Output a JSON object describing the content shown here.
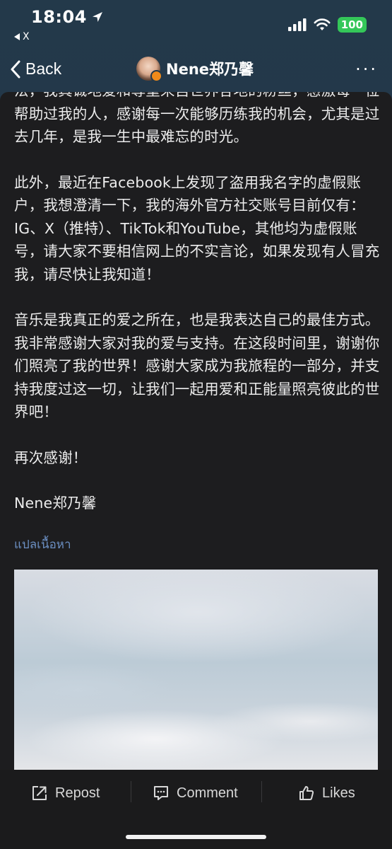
{
  "status_bar": {
    "time": "18:04",
    "back_app": "X",
    "battery": "100",
    "colors": {
      "battery": "#34c759"
    },
    "icons": [
      "location-arrow-icon",
      "signal-icon",
      "wifi-icon"
    ]
  },
  "nav": {
    "back_label": "Back",
    "title": "Nene郑乃馨",
    "more_label": "···",
    "icons": [
      "chevron-left-icon",
      "verified-badge-icon"
    ]
  },
  "post": {
    "paragraphs": [
      "法，我真诚地爱和尊重来自世界各地的粉丝，感激每一位帮助过我的人，感谢每一次能够历练我的机会，尤其是过去几年，是我一生中最难忘的时光。",
      "此外，最近在Facebook上发现了盗用我名字的虚假账户，我想澄清一下，我的海外官方社交账号目前仅有：IG、X（推特）、TikTok和YouTube，其他均为虚假账号，请大家不要相信网上的不实言论，如果发现有人冒充我，请尽快让我知道！",
      "音乐是我真正的爱之所在，也是我表达自己的最佳方式。我非常感谢大家对我的爱与支持。在这段时间里，谢谢你们照亮了我的世界！感谢大家成为我旅程的一部分，并支持我度过这一切，让我们一起用爱和正能量照亮彼此的世界吧！",
      "再次感谢！",
      "Nene郑乃馨"
    ],
    "translate_label": "แปลเนื้อหา",
    "colors": {
      "link": "#6b8fc2",
      "card_bg": "#1d1d1f",
      "header_bg": "#22384a"
    }
  },
  "actions": {
    "repost_label": "Repost",
    "comment_label": "Comment",
    "likes_label": "Likes"
  }
}
